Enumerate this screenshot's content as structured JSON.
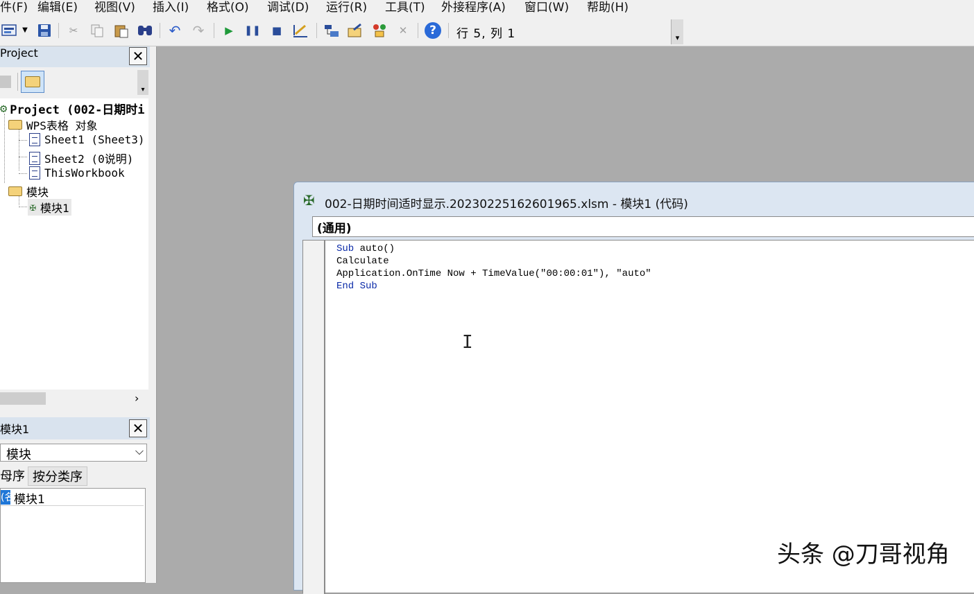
{
  "menubar": {
    "items": [
      "件(F)",
      "编辑(E)",
      "视图(V)",
      "插入(I)",
      "格式(O)",
      "调试(D)",
      "运行(R)",
      "工具(T)",
      "外接程序(A)",
      "窗口(W)",
      "帮助(H)"
    ]
  },
  "toolbar": {
    "cursor_position": "行 5, 列 1",
    "help_glyph": "?",
    "overflow_glyph": "▾"
  },
  "project_panel": {
    "title": "Project",
    "close_glyph": "✕",
    "tree": {
      "root": "Project (002-日期时i",
      "wps_objects": "WPS表格 对象",
      "sheet1": "Sheet1 (Sheet3)",
      "sheet2": "Sheet2 (0说明)",
      "this_workbook": "ThisWorkbook",
      "modules_folder": "模块",
      "module1": "模块1"
    },
    "scroll_right": "›"
  },
  "properties_panel": {
    "title": "模块1",
    "close_glyph": "✕",
    "object_select": "模块",
    "select_arrow": "⌵",
    "tab_alphabetic": "母序",
    "tab_categorized": "按分类序",
    "row_key": "(名称)",
    "row_value": "模块1"
  },
  "code_window": {
    "title": "002-日期时间适时显示.20230225162601965.xlsm - 模块1 (代码)",
    "object_combo": "(通用)",
    "lines": [
      {
        "kw": "Sub",
        "rest": " auto()"
      },
      {
        "kw": "",
        "rest": "Calculate"
      },
      {
        "kw": "",
        "rest": "Application.OnTime Now + TimeValue(\"00:00:01\"), \"auto\""
      },
      {
        "kw": "End Sub",
        "rest": ""
      }
    ]
  },
  "colors": {
    "workspace": "#ababab",
    "panel_header": "#d9e3ee",
    "keyword": "#0a2aa8",
    "selection": "#1f77d8"
  },
  "watermark": "头条 @刀哥视角"
}
